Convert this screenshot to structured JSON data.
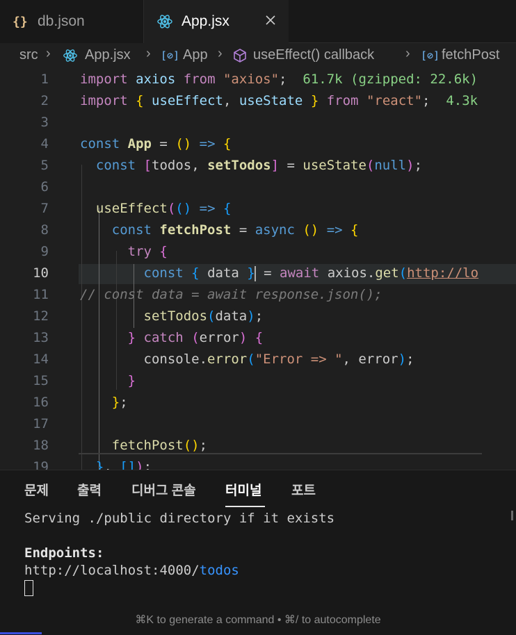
{
  "tabs": [
    {
      "label": "db.json",
      "icon": "json-braces-icon",
      "active": false
    },
    {
      "label": "App.jsx",
      "icon": "react-icon",
      "active": true,
      "close": "✕"
    }
  ],
  "breadcrumb": {
    "src": "src",
    "file": "App.jsx",
    "component": "App",
    "callback": "useEffect() callback",
    "func": "fetchPost"
  },
  "editor": {
    "line_numbers": [
      "1",
      "2",
      "3",
      "4",
      "5",
      "6",
      "7",
      "8",
      "9",
      "10",
      "11",
      "12",
      "13",
      "14",
      "15",
      "16",
      "17",
      "18",
      "19"
    ],
    "active_line": "10",
    "inlay_axios": "61.7k (gzipped: 22.6k)",
    "inlay_react": "4.3k",
    "url_fragment": "http://lo",
    "comment_line": "// const data = await response.json();",
    "error_string": "\"Error => \""
  },
  "panel": {
    "tabs": [
      "문제",
      "출력",
      "디버그 콘솔",
      "터미널",
      "포트"
    ],
    "active_tab": "터미널",
    "terminal_line1": "Serving ./public directory if it exists",
    "endpoints_label": "Endpoints:",
    "endpoint_base": "http://localhost:4000/",
    "endpoint_path": "todos",
    "hint": "⌘K to generate a command • ⌘/ to autocomplete"
  }
}
